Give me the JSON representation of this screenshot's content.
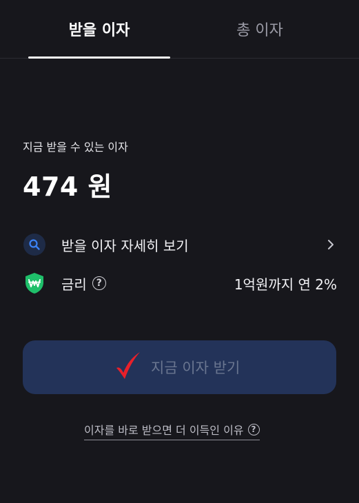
{
  "tabs": {
    "active": "받을 이자",
    "inactive": "총 이자"
  },
  "summary": {
    "label": "지금 받을 수 있는 이자",
    "amount": "474 원"
  },
  "rows": {
    "detail_label": "받을 이자 자세히 보기",
    "rate_label": "금리",
    "rate_help": "?",
    "rate_value": "1억원까지 연 2%"
  },
  "cta": {
    "label": "지금 이자 받기"
  },
  "footer": {
    "link_text": "이자를 바로 받으면 더 이득인 이유",
    "help": "?"
  },
  "icons": {
    "search": "search-icon",
    "shield": "shield-won-icon",
    "chevron": "chevron-right-icon",
    "check": "red-check-mark-icon"
  },
  "colors": {
    "background": "#17171c",
    "cta_background": "#233359",
    "shield_green": "#1fbf6a",
    "search_blue": "#3b82f6",
    "check_red": "#e8202a"
  }
}
